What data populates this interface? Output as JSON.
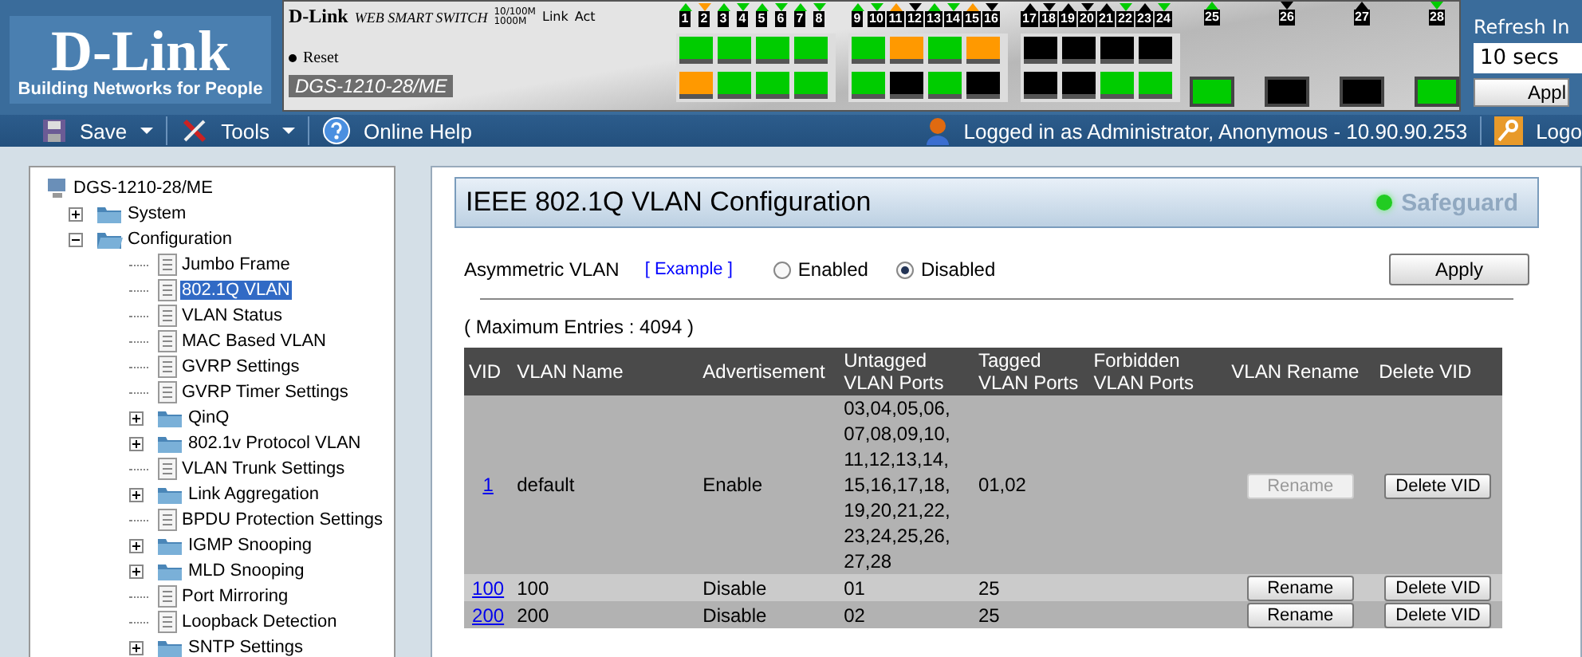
{
  "header": {
    "logo": "D-Link",
    "tagline": "Building Networks for People",
    "switch_panel": {
      "brand": "D-Link",
      "subtitle": "WEB SMART SWITCH",
      "legend": [
        "10/100M",
        "1000M",
        "Link",
        "Act"
      ],
      "reset": "Reset",
      "model": "DGS-1210-28/ME",
      "ports": [
        {
          "label": "1",
          "color": "#00cc00"
        },
        {
          "label": "2",
          "color": "#ff9900"
        },
        {
          "label": "3",
          "color": "#00cc00"
        },
        {
          "label": "4",
          "color": "#00cc00"
        },
        {
          "label": "5",
          "color": "#00cc00"
        },
        {
          "label": "6",
          "color": "#00cc00"
        },
        {
          "label": "7",
          "color": "#00cc00"
        },
        {
          "label": "8",
          "color": "#00cc00"
        },
        {
          "label": "9",
          "color": "#00cc00"
        },
        {
          "label": "10",
          "color": "#00cc00"
        },
        {
          "label": "11",
          "color": "#ff9900"
        },
        {
          "label": "12",
          "color": "#000000"
        },
        {
          "label": "13",
          "color": "#00cc00"
        },
        {
          "label": "14",
          "color": "#00cc00"
        },
        {
          "label": "15",
          "color": "#ff9900"
        },
        {
          "label": "16",
          "color": "#000000"
        },
        {
          "label": "17",
          "color": "#000000"
        },
        {
          "label": "18",
          "color": "#000000"
        },
        {
          "label": "19",
          "color": "#000000"
        },
        {
          "label": "20",
          "color": "#000000"
        },
        {
          "label": "21",
          "color": "#000000"
        },
        {
          "label": "22",
          "color": "#00cc00"
        },
        {
          "label": "23",
          "color": "#000000"
        },
        {
          "label": "24",
          "color": "#00cc00"
        },
        {
          "label": "25",
          "color": "#00cc00"
        },
        {
          "label": "26",
          "color": "#000000"
        },
        {
          "label": "27",
          "color": "#000000"
        },
        {
          "label": "28",
          "color": "#00cc00"
        }
      ]
    },
    "refresh": {
      "label": "Refresh In",
      "value": "10 secs",
      "button": "Appl"
    }
  },
  "toolbar": {
    "items": [
      "Save",
      "Tools",
      "Online Help"
    ],
    "login": "Logged in as Administrator, Anonymous - 10.90.90.253",
    "logout": "Logo"
  },
  "tree": {
    "root": "DGS-1210-28/ME",
    "items": [
      {
        "label": "System",
        "kind": "folder",
        "expanded": false,
        "selected": false
      },
      {
        "label": "Configuration",
        "kind": "folder",
        "expanded": true,
        "selected": false,
        "children": [
          {
            "label": "Jumbo Frame",
            "kind": "page",
            "selected": false
          },
          {
            "label": "802.1Q VLAN",
            "kind": "page",
            "selected": true
          },
          {
            "label": "VLAN Status",
            "kind": "page",
            "selected": false
          },
          {
            "label": "MAC Based VLAN",
            "kind": "page",
            "selected": false
          },
          {
            "label": "GVRP Settings",
            "kind": "page",
            "selected": false
          },
          {
            "label": "GVRP Timer Settings",
            "kind": "page",
            "selected": false
          },
          {
            "label": "QinQ",
            "kind": "folder",
            "expanded": false,
            "selected": false
          },
          {
            "label": "802.1v Protocol VLAN",
            "kind": "folder",
            "expanded": false,
            "selected": false
          },
          {
            "label": "VLAN Trunk Settings",
            "kind": "page",
            "selected": false
          },
          {
            "label": "Link Aggregation",
            "kind": "folder",
            "expanded": false,
            "selected": false
          },
          {
            "label": "BPDU Protection Settings",
            "kind": "page",
            "selected": false
          },
          {
            "label": "IGMP Snooping",
            "kind": "folder",
            "expanded": false,
            "selected": false
          },
          {
            "label": "MLD Snooping",
            "kind": "folder",
            "expanded": false,
            "selected": false
          },
          {
            "label": "Port Mirroring",
            "kind": "page",
            "selected": false
          },
          {
            "label": "Loopback Detection",
            "kind": "page",
            "selected": false
          },
          {
            "label": "SNTP Settings",
            "kind": "folder",
            "expanded": false,
            "selected": false
          }
        ]
      }
    ]
  },
  "panel": {
    "title": "IEEE 802.1Q VLAN Configuration",
    "safeguard": "Safeguard",
    "asymmetric": {
      "label": "Asymmetric VLAN",
      "example": "[ Example ]",
      "options": [
        {
          "label": "Enabled",
          "selected": false
        },
        {
          "label": "Disabled",
          "selected": true
        }
      ],
      "apply": "Apply"
    },
    "max_entries": "( Maximum Entries : 4094 )",
    "table": {
      "columns": [
        "VID",
        "VLAN Name",
        "Advertisement",
        "Untagged VLAN Ports",
        "Tagged VLAN Ports",
        "Forbidden VLAN Ports",
        "VLAN Rename",
        "Delete VID"
      ],
      "rows": [
        {
          "vid": "1",
          "name": "default",
          "advertisement": "Enable",
          "untagged": "03,04,05,06, 07,08,09,10, 11,12,13,14, 15,16,17,18, 19,20,21,22, 23,24,25,26, 27,28",
          "tagged": "01,02",
          "rename": "Rename",
          "rename_disabled": true,
          "delete": "Delete VID"
        },
        {
          "vid": "100",
          "name": "100",
          "advertisement": "Disable",
          "untagged": "01",
          "tagged": "25",
          "rename": "Rename",
          "rename_disabled": false,
          "delete": "Delete VID"
        },
        {
          "vid": "200",
          "name": "200",
          "advertisement": "Disable",
          "untagged": "02",
          "tagged": "25",
          "rename": "Rename",
          "rename_disabled": false,
          "delete": "Delete VID"
        }
      ]
    }
  }
}
